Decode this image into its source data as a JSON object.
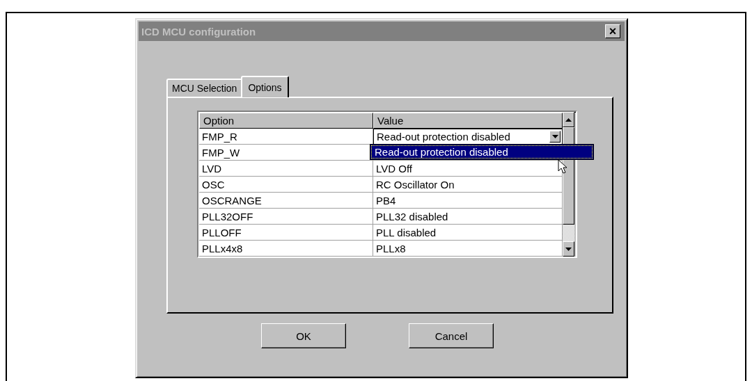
{
  "window": {
    "title": "ICD MCU configuration",
    "close": "×"
  },
  "tabs": [
    {
      "label": "MCU Selection",
      "selected": false
    },
    {
      "label": "Options",
      "selected": true
    }
  ],
  "table": {
    "columns": [
      "Option",
      "Value"
    ],
    "rows": [
      {
        "option": "FMP_R",
        "value": "Read-out protection disabled",
        "kind": "combo"
      },
      {
        "option": "FMP_W",
        "value": "",
        "kind": "text"
      },
      {
        "option": "LVD",
        "value": "LVD Off",
        "kind": "text"
      },
      {
        "option": "OSC",
        "value": "RC Oscillator On",
        "kind": "text"
      },
      {
        "option": "OSCRANGE",
        "value": "PB4",
        "kind": "text"
      },
      {
        "option": "PLL32OFF",
        "value": "PLL32 disabled",
        "kind": "text"
      },
      {
        "option": "PLLOFF",
        "value": "PLL disabled",
        "kind": "text"
      },
      {
        "option": "PLLx4x8",
        "value": "PLLx8",
        "kind": "text"
      }
    ]
  },
  "dropdown": {
    "items": [
      {
        "label": "Read-out protection disabled",
        "selected": true
      }
    ]
  },
  "buttons": [
    "OK",
    "Cancel"
  ]
}
